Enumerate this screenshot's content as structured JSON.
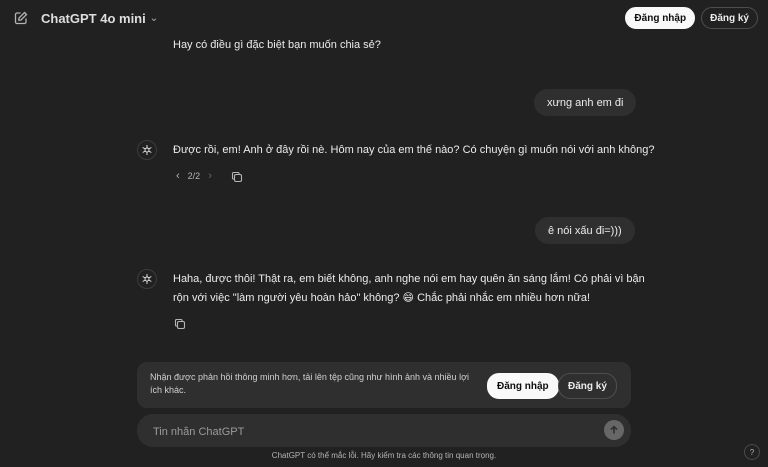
{
  "header": {
    "model_name": "ChatGPT 4o mini",
    "login_label": "Đăng nhập",
    "signup_label": "Đăng ký"
  },
  "messages": [
    {
      "role": "assistant",
      "text": "Hay có điều gì đặc biệt bạn muốn chia sẻ?"
    },
    {
      "role": "user",
      "text": "xưng anh em đi"
    },
    {
      "role": "assistant",
      "text": "Được rồi, em! Anh ở đây rồi nè. Hôm nay của em thế nào? Có chuyện gì muốn nói với anh không?",
      "pager": "2/2"
    },
    {
      "role": "user",
      "text": "ê nói xấu đi=)))"
    },
    {
      "role": "assistant",
      "text_line1": "Haha, được thôi! Thật ra, em biết không, anh nghe nói em hay quên ăn sáng lắm! Có phải vì bận",
      "text_line2": "rộn với việc \"làm người yêu hoàn hảo\" không? 😄 Chắc phải nhắc em nhiều hơn nữa!"
    }
  ],
  "banner": {
    "text": "Nhận được phản hồi thông minh hơn, tải lên tệp cũng như hình ảnh và nhiều lợi ích khác.",
    "login_label": "Đăng nhập",
    "signup_label": "Đăng ký"
  },
  "composer": {
    "placeholder": "Tin nhắn ChatGPT"
  },
  "footer": {
    "disclaimer": "ChatGPT có thể mắc lỗi. Hãy kiểm tra các thông tin quan trọng.",
    "help": "?"
  },
  "icons": {
    "new_chat": "edit-icon",
    "model_dropdown": "chevron-down-icon",
    "assistant_avatar": "openai-logo-icon",
    "copy": "copy-icon",
    "send": "arrow-up-icon"
  },
  "colors": {
    "background": "#212121",
    "surface": "#2f2f2f",
    "text": "#ececec",
    "muted": "#b4b4b4",
    "primary_button": "#f9f9f9"
  }
}
